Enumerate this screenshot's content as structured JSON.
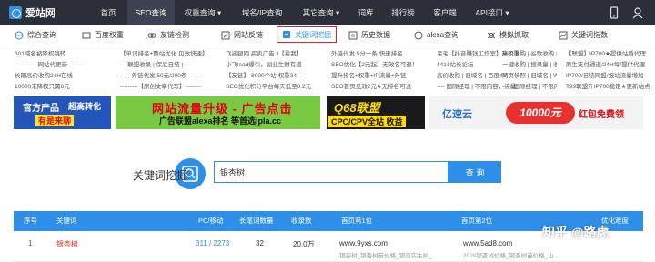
{
  "brand": {
    "name": "爱站网"
  },
  "topnav": {
    "items": [
      "首页",
      "SEO查询",
      "权重查询 ▾",
      "域名/IP查询",
      "其它查询 ▾",
      "词库",
      "排行榜",
      "客户端",
      "API接口 ▾"
    ],
    "active_index": 1
  },
  "toolbar": {
    "items": [
      "综合查询",
      "百度权重",
      "友链检测",
      "网站反链",
      "关键词挖掘",
      "历史数据",
      "alexa查询",
      "模拟抓取",
      "关键词指数"
    ],
    "active_index": 4
  },
  "links": {
    "columns": [
      [
        "301域名被降权跳转",
        "----------- 网站代更新 ------",
        "长期高价收购24H在线",
        "10000未降权只需8元"
      ],
      [
        "【单词排名+整站优化 见效快速】",
        "--- 联盟收录 | 保底日结 | ---",
        "----- 外链代发 50元/200条 -----",
        "---------【原创文章代写】--------"
      ],
      [
        "飞鲨腿网 买卖广告 ‖【看我】",
        "小飞lead爆引，副业生财有道",
        "【友链】-8000个站-权重34----",
        "SEO优化积分平台每天低至0.2元"
      ],
      [
        "外链代发 5分一条 快速排名",
        "SEO优化【2元起】无效名可退！",
        "提升排名+权重+IP流量+外链",
        "SEO首页见效2元★无排名可退"
      ],
      [
        "吊毛【抖音赚钱工作室】升权重",
        "4414站长论坛",
        "高价收购 | 旧域名 | 百度4V",
        "---- 国际经理 | 不限内容，流量"
      ],
      [
        "高价收购 | 谷歌收购 | 权重站",
        "一键收购 | 搜录量 | 收录站",
        "网页快照 | 旧域名 | WAP站",
        "----- 国际经理 | 不限内容 | 流量 --"
      ],
      [
        "【联盟】IP700★提供站盾代理",
        "原生支付通道/24H每/提供代理",
        "IP700/日结网盟/报站流量增加",
        "T99联盟升IP700稳定★更新站点"
      ]
    ]
  },
  "ads": {
    "ad1": {
      "line1": "官方产品",
      "line2": "有是来聊",
      "line1b": "超高转化"
    },
    "ad2": {
      "line1": "网站流量升级 - 广告点击",
      "line2": "广告联盟alexa排名 等首选ipla.cc"
    },
    "ad3": {
      "line1": "Q68联盟",
      "line2": "CPC/CPV全站 收益"
    },
    "ad4": {
      "brand": "亿速云",
      "big": "10000元",
      "tail": "红包免费领"
    }
  },
  "search": {
    "title": "关键词挖掘",
    "value": "银杏树",
    "button": "查 询"
  },
  "table": {
    "headers": [
      "序号",
      "关键词",
      "PC/移动",
      "长尾词数量",
      "收录数",
      "首页第1位",
      "首页第2位",
      "优化难度"
    ],
    "rows": [
      {
        "idx": "1",
        "keyword": "银杏树",
        "pc_mobile": "311 / 2273",
        "longtail": "32",
        "indexed": "20.0万",
        "first_site": "www.9yxs.com",
        "first_desc": "银杏树_银杏树苗价格_银杏实生树_...",
        "second_site": "www.5ad8.com",
        "second_desc": "2020银杏树价格_银杏树苗价格_山..."
      }
    ]
  },
  "watermark": "知乎 @路虎",
  "colors": {
    "accent": "#2f8ee8",
    "highlight_red": "#e0242b",
    "nav_bg": "#2b2f3a"
  }
}
